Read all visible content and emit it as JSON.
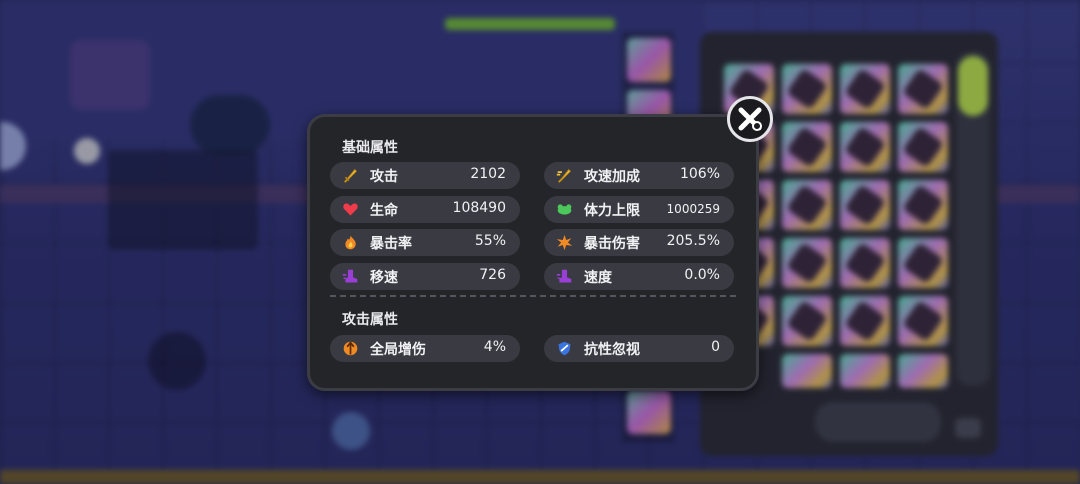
{
  "panel": {
    "sections": [
      {
        "title": "基础属性"
      },
      {
        "title": "攻击属性"
      }
    ],
    "base_stats": [
      {
        "name": "攻击",
        "value": "2102",
        "icon": "sword-icon",
        "color": "#f2c23c"
      },
      {
        "name": "攻速加成",
        "value": "106%",
        "icon": "attack-speed-icon",
        "color": "#f2c23c"
      },
      {
        "name": "生命",
        "value": "108490",
        "icon": "heart-icon",
        "color": "#ef3b4a"
      },
      {
        "name": "体力上限",
        "value": "1000259",
        "icon": "stamina-icon",
        "color": "#4cc85a"
      },
      {
        "name": "暴击率",
        "value": "55%",
        "icon": "crit-rate-icon",
        "color": "#f08a24"
      },
      {
        "name": "暴击伤害",
        "value": "205.5%",
        "icon": "crit-damage-icon",
        "color": "#f08a24"
      },
      {
        "name": "移速",
        "value": "726",
        "icon": "boot-icon",
        "color": "#9a3fd6"
      },
      {
        "name": "速度",
        "value": "0.0%",
        "icon": "speed-boot-icon",
        "color": "#9a3fd6"
      }
    ],
    "attack_stats": [
      {
        "name": "全局增伤",
        "value": "4%",
        "icon": "global-damage-icon",
        "color": "#f08a24"
      },
      {
        "name": "抗性忽视",
        "value": "0",
        "icon": "shield-ignore-icon",
        "color": "#3a74e0"
      }
    ]
  }
}
